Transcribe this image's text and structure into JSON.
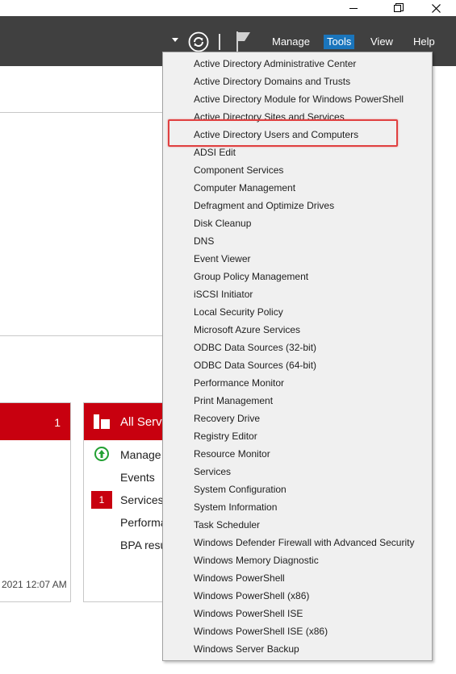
{
  "window": {
    "controls": [
      "minimize",
      "restore",
      "close"
    ]
  },
  "toolbar": {
    "manage": "Manage",
    "tools": "Tools",
    "view": "View",
    "help": "Help",
    "active_color": "#1a75bc"
  },
  "dashboard": {
    "tile1": {
      "count": "1",
      "timestamp": "2021 12:07 AM"
    },
    "tile2": {
      "title": "All Serv",
      "items": [
        "Manage",
        "Events",
        "Services",
        "Performa",
        "BPA resu"
      ],
      "services_badge": "1"
    },
    "brand_color": "#c8000f"
  },
  "tools_menu": {
    "items": [
      "Active Directory Administrative Center",
      "Active Directory Domains and Trusts",
      "Active Directory Module for Windows PowerShell",
      "Active Directory Sites and Services",
      "Active Directory Users and Computers",
      "ADSI Edit",
      "Component Services",
      "Computer Management",
      "Defragment and Optimize Drives",
      "Disk Cleanup",
      "DNS",
      "Event Viewer",
      "Group Policy Management",
      "iSCSI Initiator",
      "Local Security Policy",
      "Microsoft Azure Services",
      "ODBC Data Sources (32-bit)",
      "ODBC Data Sources (64-bit)",
      "Performance Monitor",
      "Print Management",
      "Recovery Drive",
      "Registry Editor",
      "Resource Monitor",
      "Services",
      "System Configuration",
      "System Information",
      "Task Scheduler",
      "Windows Defender Firewall with Advanced Security",
      "Windows Memory Diagnostic",
      "Windows PowerShell",
      "Windows PowerShell (x86)",
      "Windows PowerShell ISE",
      "Windows PowerShell ISE (x86)",
      "Windows Server Backup"
    ],
    "highlighted_item": "Active Directory Users and Computers",
    "highlight_color": "#e04040"
  }
}
